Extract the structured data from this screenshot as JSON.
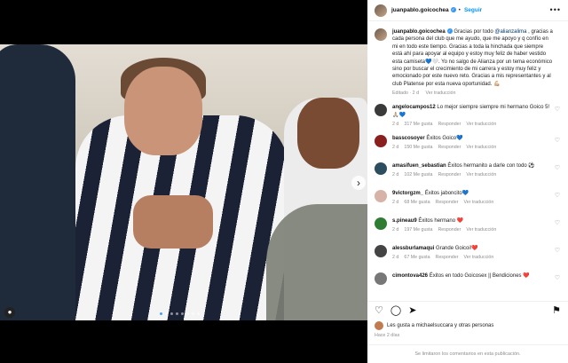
{
  "post": {
    "username": "juanpablo.goicochea",
    "follow_label": "Seguir",
    "separator": "•",
    "caption_parts": {
      "p1": "Gracias por todo ",
      "mention": "@alianzalima",
      "p2": " , gracias a cada persona del club que me ayudo, que me apoyo y q confío en mi en todo este tiempo. Gracias a toda la hinchada que siempre está ahí para apoyar al equipo y estoy muy feliz de haber vestido esta camiseta💙🤍. Yo no salgo de Alianza por un tema económico sino por buscar el crecimiento de mi carrera y estoy muy feliz y emocionado por este nuevo reto. Gracias a mis representantes y al club Platense por esta nueva oportunidad. 💪🏼"
    },
    "caption_meta": {
      "edited": "Editado · 2 d",
      "translate": "Ver traducción"
    }
  },
  "comments": [
    {
      "user": "angelocampos12",
      "text": "Lo mejor siempre siempre mi hermano Goico 5! 🙏🏼💙",
      "age": "2 d",
      "likes": "317 Me gusta",
      "reply": "Responder",
      "translate": "Ver traducción",
      "color": "#3a3a3a"
    },
    {
      "user": "basscosoyer",
      "text": "Éxitos Goico💙",
      "age": "2 d",
      "likes": "150 Me gusta",
      "reply": "Responder",
      "translate": "Ver traducción",
      "color": "#8a1f1f"
    },
    {
      "user": "amasifuen_sebastian",
      "text": "Éxitos hermanito a darle con todo ⚽",
      "age": "2 d",
      "likes": "102 Me gusta",
      "reply": "Responder",
      "translate": "Ver traducción",
      "color": "#2d4e5e"
    },
    {
      "user": "9victorgzm_",
      "text": "Éxitos jaboncito💙",
      "age": "2 d",
      "likes": "68 Me gusta",
      "reply": "Responder",
      "translate": "Ver traducción",
      "color": "#d6b2a7"
    },
    {
      "user": "s.pineau9",
      "text": "Éxitos hermano ❤️",
      "age": "2 d",
      "likes": "197 Me gusta",
      "reply": "Responder",
      "translate": "Ver traducción",
      "color": "#2f7d32"
    },
    {
      "user": "alessburlamaqui",
      "text": "Grande Goicoi!❤️",
      "age": "2 d",
      "likes": "67 Me gusta",
      "reply": "Responder",
      "translate": "Ver traducción",
      "color": "#444444"
    },
    {
      "user": "cimontova426",
      "text": "Éxitos en todo Goicosex || Bendiciones ❤️",
      "age": "",
      "likes": "",
      "reply": "",
      "translate": "",
      "color": "#777777"
    }
  ],
  "icons": {
    "more": "more-horizontal-icon",
    "heart": "heart-icon",
    "comment": "comment-icon",
    "share": "share-icon",
    "save": "bookmark-icon"
  },
  "actions": {
    "heart": "♡",
    "comment": "◯",
    "share": "➤",
    "save": "⚑",
    "more": "•••",
    "comment_heart": "♡",
    "next": "›"
  },
  "likes": {
    "text": "Les gusta a michaelsuccara y otras personas"
  },
  "posted": "Hace 2 días",
  "footer": "Se limitaron los comentarios en esta publicación."
}
